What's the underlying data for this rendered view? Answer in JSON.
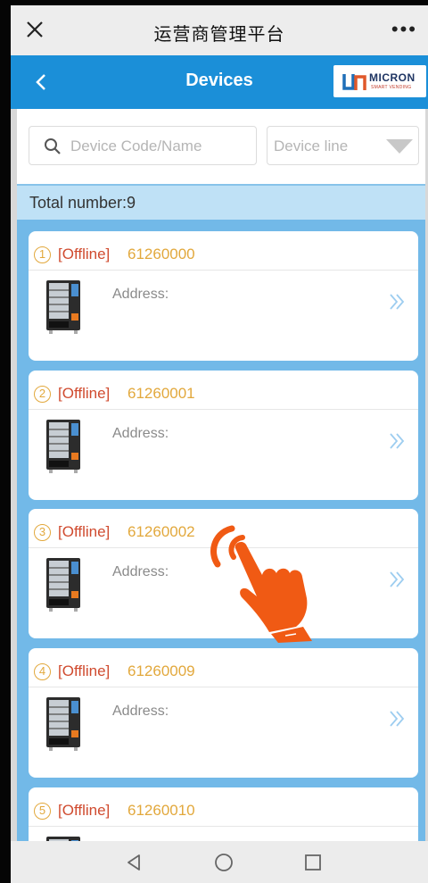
{
  "wechat_bar": {
    "title": "运营商管理平台",
    "more_label": "•••"
  },
  "header": {
    "title": "Devices",
    "logo_text": "MICRON",
    "logo_subtext": "SMART VENDING"
  },
  "search": {
    "placeholder": "Device Code/Name"
  },
  "device_line": {
    "placeholder": "Device line"
  },
  "total": {
    "label": "Total number:9"
  },
  "devices": [
    {
      "index": "1",
      "status": "[Offline]",
      "code": "61260000",
      "address_label": "Address:"
    },
    {
      "index": "2",
      "status": "[Offline]",
      "code": "61260001",
      "address_label": "Address:"
    },
    {
      "index": "3",
      "status": "[Offline]",
      "code": "61260002",
      "address_label": "Address:"
    },
    {
      "index": "4",
      "status": "[Offline]",
      "code": "61260009",
      "address_label": "Address:"
    },
    {
      "index": "5",
      "status": "[Offline]",
      "code": "61260010",
      "address_label": ""
    }
  ],
  "colors": {
    "header_blue": "#1b8fd8",
    "list_blue": "#72b9e8",
    "offline_red": "#d04b2f",
    "code_orange": "#e2a83c",
    "hand_orange": "#f05a14"
  }
}
